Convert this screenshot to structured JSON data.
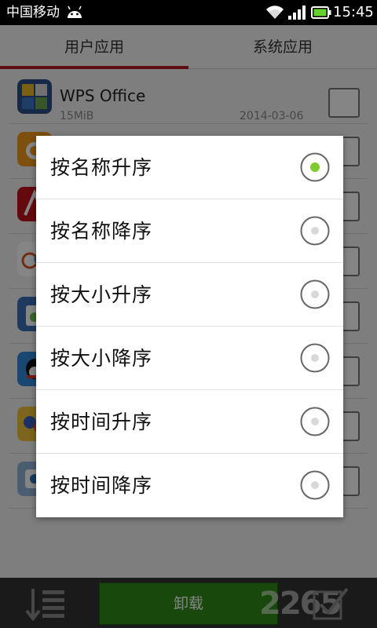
{
  "statusbar": {
    "carrier": "中国移动",
    "time": "15:45",
    "icons": [
      "android-icon",
      "wifi-icon",
      "signal-icon",
      "battery-icon"
    ]
  },
  "tabs": [
    {
      "label": "用户应用",
      "selected": true
    },
    {
      "label": "系统应用",
      "selected": false
    }
  ],
  "apps": [
    {
      "name": "WPS Office",
      "size": "15MiB",
      "date": "2014-03-06",
      "icon": "wps-office-icon",
      "checked": false
    },
    {
      "name": "",
      "size": "",
      "date": "",
      "icon": "uc-browser-icon",
      "checked": false
    },
    {
      "name": "",
      "size": "",
      "date": "",
      "icon": "adobe-reader-icon",
      "checked": false
    },
    {
      "name": "",
      "size": "",
      "date": "",
      "icon": "app-icon",
      "checked": false
    },
    {
      "name": "",
      "size": "",
      "date": "",
      "icon": "cleaner-icon",
      "checked": false
    },
    {
      "name": "",
      "size": "",
      "date": "",
      "icon": "qq-icon",
      "checked": false
    },
    {
      "name": "",
      "size": "",
      "date": "",
      "icon": "game-icon",
      "checked": false
    },
    {
      "name": "",
      "size": "",
      "date": "",
      "icon": "app-icon",
      "checked": false
    }
  ],
  "bottombar": {
    "uninstall_label": "卸载",
    "watermark": "2265"
  },
  "sort_dialog": {
    "options": [
      {
        "label": "按名称升序",
        "selected": true
      },
      {
        "label": "按名称降序",
        "selected": false
      },
      {
        "label": "按大小升序",
        "selected": false
      },
      {
        "label": "按大小降序",
        "selected": false
      },
      {
        "label": "按时间升序",
        "selected": false
      },
      {
        "label": "按时间降序",
        "selected": false
      }
    ]
  },
  "colors": {
    "tab_indicator": "#b3191d",
    "uninstall_button": "#2f8a18",
    "radio_selected": "#7dcb2d"
  }
}
